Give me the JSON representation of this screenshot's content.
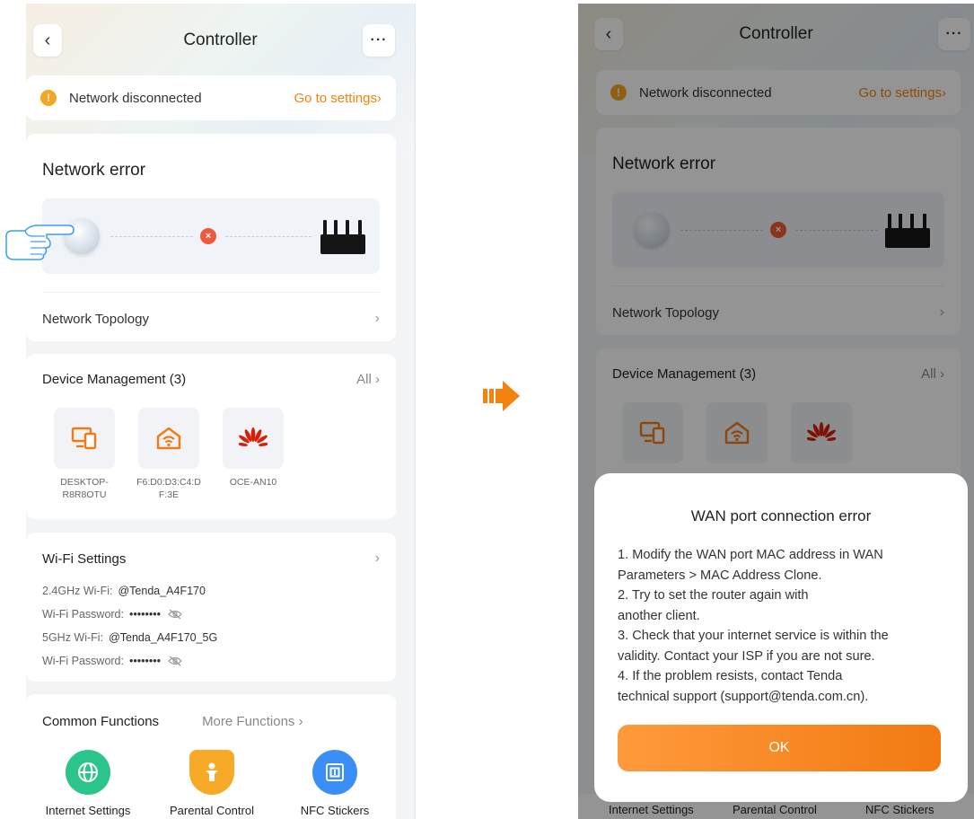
{
  "header": {
    "title": "Controller",
    "back_icon": "‹",
    "more_icon": "···"
  },
  "banner": {
    "message": "Network disconnected",
    "action": "Go to settings",
    "action_chevron": "›",
    "icon": "!"
  },
  "network": {
    "title": "Network error",
    "error_icon": "×",
    "topology_label": "Network Topology",
    "topology_chevron": "›"
  },
  "devices": {
    "title": "Device Management (3)",
    "all_label": "All",
    "all_chevron": "›",
    "items": [
      {
        "name_line1": "DESKTOP-",
        "name_line2": "R8R8OTU",
        "icon": "computer-icon"
      },
      {
        "name_line1": "F6:D0:D3:C4:D",
        "name_line2": "F:3E",
        "icon": "router-home-icon"
      },
      {
        "name_line1": "OCE-AN10",
        "name_line2": "",
        "icon": "huawei-logo-icon"
      }
    ]
  },
  "wifi": {
    "title": "Wi-Fi Settings",
    "chevron": "›",
    "lines": [
      {
        "label": "2.4GHz Wi-Fi:",
        "value": "@Tenda_A4F170"
      },
      {
        "label": "Wi-Fi Password:",
        "value": "••••••••"
      },
      {
        "label": "5GHz Wi-Fi:",
        "value": "@Tenda_A4F170_5G"
      },
      {
        "label": "Wi-Fi Password:",
        "value": "••••••••"
      }
    ]
  },
  "functions": {
    "title": "Common Functions",
    "more_label": "More Functions",
    "more_chevron": "›",
    "items": [
      {
        "label": "Internet Settings",
        "color": "#2bc48a"
      },
      {
        "label": "Parental Control",
        "color": "#f7a928"
      },
      {
        "label": "NFC Stickers",
        "color": "#3b8ef5"
      }
    ]
  },
  "dialog": {
    "title": "WAN port connection error",
    "lines": [
      "1. Modify the WAN port MAC address in WAN",
      "Parameters > MAC Address Clone.",
      "2. Try to set the router again with",
      "another client.",
      "3. Check that your internet service is within the",
      "validity. Contact your ISP if you are not sure.",
      "4. If the problem resists, contact Tenda",
      "technical support (support@tenda.com.cn)."
    ],
    "ok_label": "OK"
  },
  "colors": {
    "accent": "#f5810f",
    "error": "#ef5a3c",
    "warning": "#f5a623",
    "ok_button": "#f27a12"
  }
}
